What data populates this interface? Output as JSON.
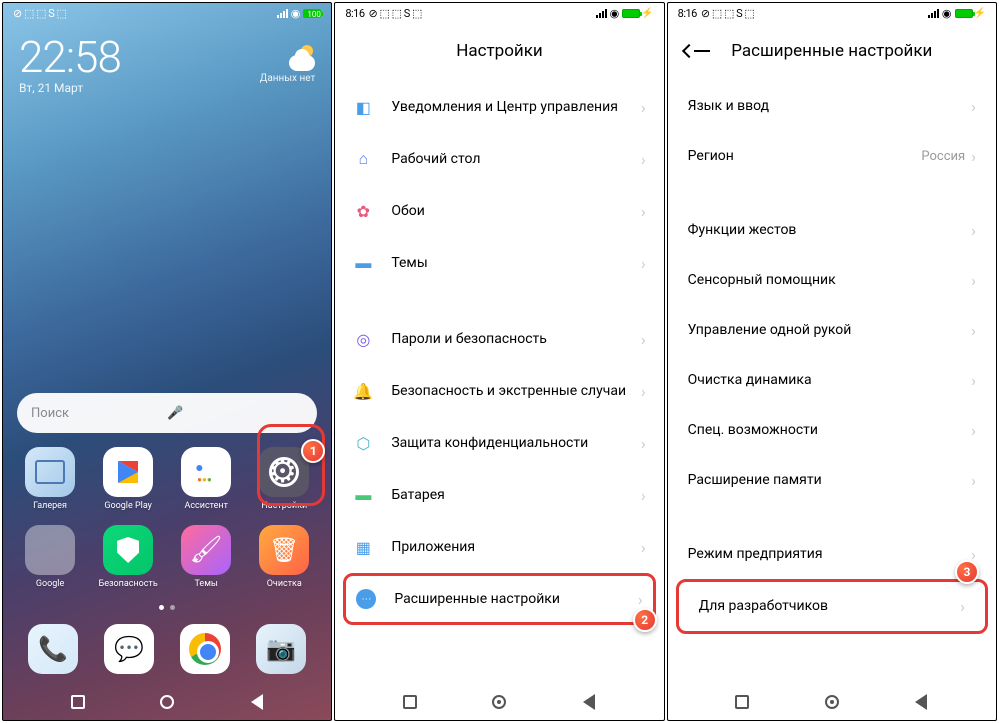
{
  "phone1": {
    "status": {
      "left_icons": "⊘ ⬚ ⬚ S ⬚",
      "battery": "100"
    },
    "clock": "22:58",
    "date": "Вт, 21 Март",
    "weather_text": "Данных нет",
    "search_placeholder": "Поиск",
    "apps_row1": [
      {
        "name": "gallery",
        "label": "Галерея"
      },
      {
        "name": "google-play",
        "label": "Google Play"
      },
      {
        "name": "assistant",
        "label": "Ассистент"
      },
      {
        "name": "settings",
        "label": "Настройки"
      }
    ],
    "apps_row2": [
      {
        "name": "google-folder",
        "label": "Google"
      },
      {
        "name": "security",
        "label": "Безопасность"
      },
      {
        "name": "themes",
        "label": "Темы"
      },
      {
        "name": "cleaner",
        "label": "Очистка"
      }
    ],
    "dock": [
      {
        "name": "phone"
      },
      {
        "name": "messages"
      },
      {
        "name": "chrome"
      },
      {
        "name": "camera"
      }
    ],
    "badge1": "1"
  },
  "phone2": {
    "status": {
      "time": "8:16",
      "icons": "⊘ ⬚ ⬚ S ⬚"
    },
    "title": "Настройки",
    "items": [
      {
        "icon": "notif",
        "label": "Уведомления и Центр управления"
      },
      {
        "icon": "home",
        "label": "Рабочий стол"
      },
      {
        "icon": "wallpaper",
        "label": "Обои"
      },
      {
        "icon": "theme",
        "label": "Темы"
      }
    ],
    "items2": [
      {
        "icon": "lock",
        "label": "Пароли и безопасность"
      },
      {
        "icon": "emergency",
        "label": "Безопасность и экстренные случаи"
      },
      {
        "icon": "privacy",
        "label": "Защита конфиденциальности"
      },
      {
        "icon": "battery2",
        "label": "Батарея"
      },
      {
        "icon": "apps",
        "label": "Приложения"
      }
    ],
    "highlighted": {
      "icon": "adv",
      "label": "Расширенные настройки"
    },
    "badge2": "2"
  },
  "phone3": {
    "status": {
      "time": "8:16",
      "icons": "⊘ ⬚ ⬚ S ⬚"
    },
    "title": "Расширенные настройки",
    "items": [
      {
        "label": "Язык и ввод"
      },
      {
        "label": "Регион",
        "value": "Россия"
      }
    ],
    "items2": [
      {
        "label": "Функции жестов"
      },
      {
        "label": "Сенсорный помощник"
      },
      {
        "label": "Управление одной рукой"
      },
      {
        "label": "Очистка динамика"
      },
      {
        "label": "Спец. возможности"
      },
      {
        "label": "Расширение памяти"
      }
    ],
    "items3": [
      {
        "label": "Режим предприятия"
      }
    ],
    "highlighted": {
      "label": "Для разработчиков"
    },
    "badge3": "3"
  }
}
